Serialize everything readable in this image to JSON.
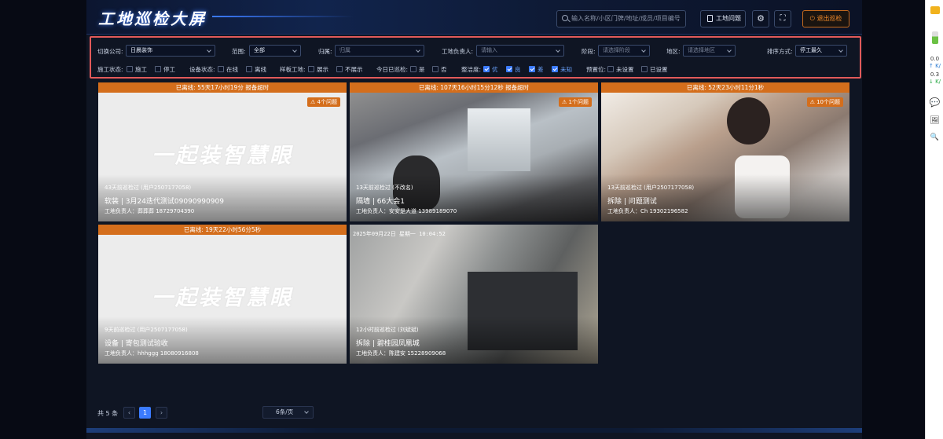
{
  "header": {
    "title": "工地巡检大屏",
    "search_placeholder": "输入名称/小区门牌/地址/成员/项目编号",
    "issue_button": "工地问题",
    "exit_button": "退出巡检"
  },
  "filters": {
    "company_label": "切换公司:",
    "company_value": "日晨装饰",
    "scope_label": "范围:",
    "scope_value": "全部",
    "belong_label": "归属:",
    "belong_value": "归属",
    "manager_label": "工地负责人:",
    "manager_placeholder": "请输入",
    "stage_label": "阶段:",
    "stage_placeholder": "请选择阶段",
    "region_label": "地区:",
    "region_placeholder": "请选择地区",
    "sort_label": "排序方式:",
    "sort_value": "停工最久",
    "construction_label": "施工状态:",
    "construction_options": [
      "施工",
      "停工"
    ],
    "device_label": "设备状态:",
    "device_options": [
      "在线",
      "离线"
    ],
    "sample_label": "样板工地:",
    "sample_options": [
      "展示",
      "不展示"
    ],
    "patrolled_label": "今日已巡检:",
    "patrolled_options": [
      "是",
      "否"
    ],
    "tidy_label": "整洁度:",
    "tidy_options": [
      "优",
      "良",
      "差",
      "未知"
    ],
    "preset_label": "预置位:",
    "preset_options": [
      "未设置",
      "已设置"
    ]
  },
  "cards": [
    {
      "status": "已离线: 55天17小时19分 报备超时",
      "issues": "4个问题",
      "watermark": "一起装智慧眼",
      "patrol": "43天前巡检过 (用户2507177058)",
      "name": "软装 | 3月24迭代测试09090990909",
      "manager": "工地负责人：葬葬葬 18729704390"
    },
    {
      "status": "已离线: 107天16小时15分12秒 报备超时",
      "issues": "1个问题",
      "patrol": "13天前巡检过 (不改名)",
      "name": "隔墙 | 66大会1",
      "manager": "工地负责人：安安是大道 13989189070"
    },
    {
      "status": "已离线: 52天23小时11分1秒",
      "issues": "10个问题",
      "patrol": "13天前巡检过 (用户2507177058)",
      "name": "拆除 | 问题测试",
      "manager": "工地负责人：Ch 19302196582"
    },
    {
      "status": "已离线: 19天22小时56分5秒",
      "watermark": "一起装智慧眼",
      "patrol": "9天前巡检过 (用户2507177058)",
      "name": "设备 | 寄包测试验收",
      "manager": "工地负责人：hhhggg 18080916808"
    },
    {
      "timestamp": "2025年09月22日 星期一 10:04:52",
      "patrol": "12小时前巡检过 (刘斌斌)",
      "name": "拆除 | 碧桂园凤凰城",
      "manager": "工地负责人：陈建安 15228909068"
    }
  ],
  "pagination": {
    "total": "共 5 条",
    "prev": "‹",
    "current_page": "1",
    "next": "›",
    "page_size": "6条/页"
  },
  "sidebar": {
    "n1": "0.0",
    "k1": "K/",
    "n2": "0.3",
    "k2": "K/"
  },
  "colors": {
    "accent": "#3b7bff",
    "warning": "#d46e1c",
    "highlight_border": "#e25a5a",
    "exit": "#f08a2a"
  }
}
